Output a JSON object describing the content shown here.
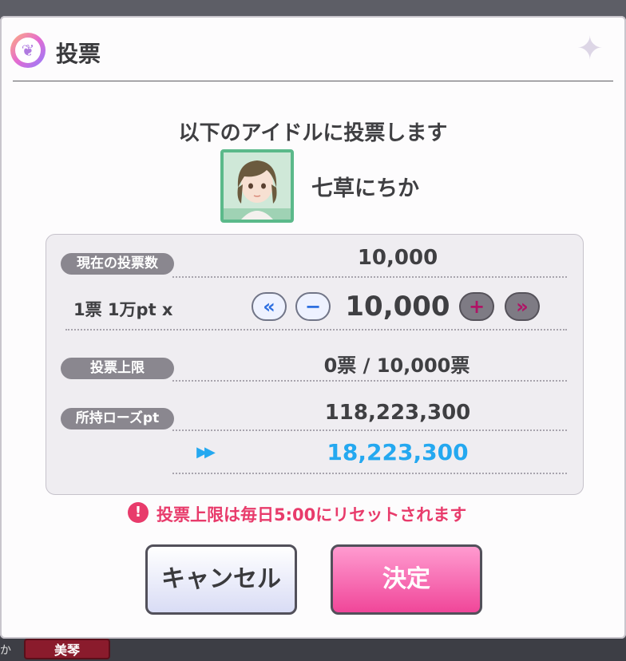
{
  "header": {
    "title": "投票",
    "title_icon": "wing-badge-icon",
    "sparkle_icon": "sparkle-icon"
  },
  "subtitle": "以下のアイドルに投票します",
  "idol": {
    "name": "七草にちか"
  },
  "panel": {
    "current_votes_label": "現在の投票数",
    "current_votes_value": "10,000",
    "rate_label": "1票 1万pt x",
    "vote_amount": "10,000",
    "btn_min": "«",
    "btn_minus": "−",
    "btn_plus": "+",
    "btn_max": "»",
    "limit_label": "投票上限",
    "limit_value": "0票 / 10,000票",
    "rose_label": "所持ローズpt",
    "rose_value": "118,223,300",
    "after_arrow": "▶▶",
    "rose_after": "18,223,300"
  },
  "notice": {
    "icon": "!",
    "text": "投票上限は毎日5:00にリセットされます"
  },
  "buttons": {
    "cancel": "キャンセル",
    "ok": "決定"
  },
  "background": {
    "tag": "美琴",
    "left_char": "か"
  },
  "colors": {
    "accent_pink": "#e83b6b",
    "accent_blue": "#24a8f0",
    "ok_button": "#f04699"
  }
}
